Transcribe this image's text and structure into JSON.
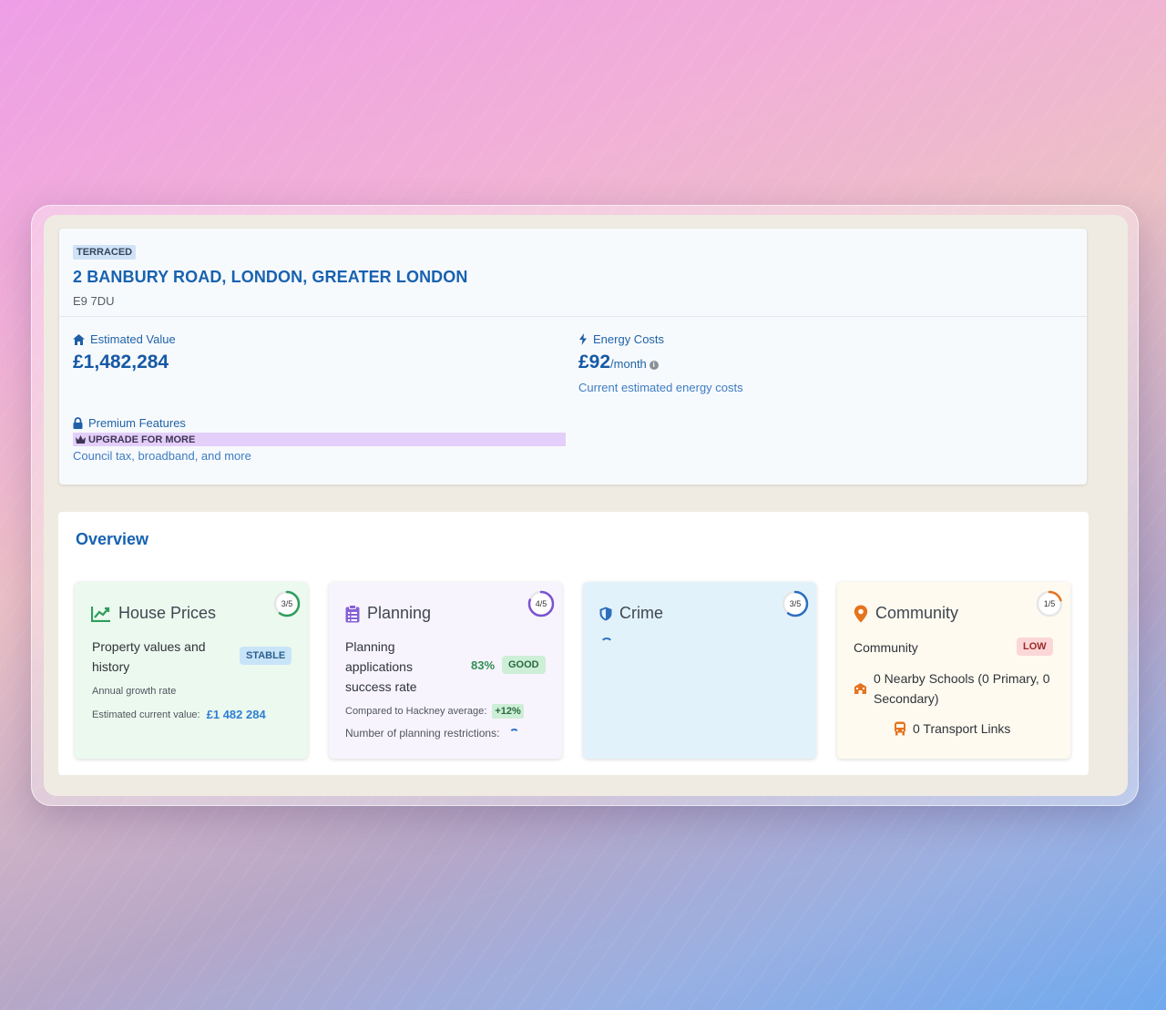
{
  "property": {
    "type_badge": "TERRACED",
    "address": "2 BANBURY ROAD, LONDON, GREATER LONDON",
    "postcode": "E9 7DU",
    "estimated_value_label": "Estimated Value",
    "estimated_value": "£1,482,284",
    "energy_label": "Energy Costs",
    "energy_value": "£92",
    "energy_unit": "/month",
    "energy_sub": "Current estimated energy costs",
    "premium_label": "Premium Features",
    "upgrade_label": "UPGRADE FOR MORE",
    "premium_sub": "Council tax, broadband, and more"
  },
  "overview": {
    "title": "Overview",
    "house_prices": {
      "title": "House Prices",
      "score": "3/5",
      "score_fraction": 0.6,
      "desc": "Property values and history",
      "badge": "STABLE",
      "growth_label": "Annual growth rate",
      "current_label": "Estimated current value:",
      "current_value": "£1 482 284"
    },
    "planning": {
      "title": "Planning",
      "score": "4/5",
      "score_fraction": 0.8,
      "desc": "Planning applications success rate",
      "rate": "83%",
      "badge": "GOOD",
      "compare_label": "Compared to Hackney average:",
      "compare_value": "+12%",
      "restrictions_label": "Number of planning restrictions:"
    },
    "crime": {
      "title": "Crime",
      "score": "3/5",
      "score_fraction": 0.6
    },
    "community": {
      "title": "Community",
      "score": "1/5",
      "score_fraction": 0.2,
      "label": "Community",
      "badge": "LOW",
      "schools": "0 Nearby Schools (0 Primary, 0 Secondary)",
      "transport": "0 Transport Links"
    }
  },
  "colors": {
    "accent": "#1762b0",
    "house_prices_ring": "#2f9e5a",
    "planning_ring": "#7b53d0",
    "crime_ring": "#2d6fbd",
    "community_ring": "#e5741f"
  }
}
